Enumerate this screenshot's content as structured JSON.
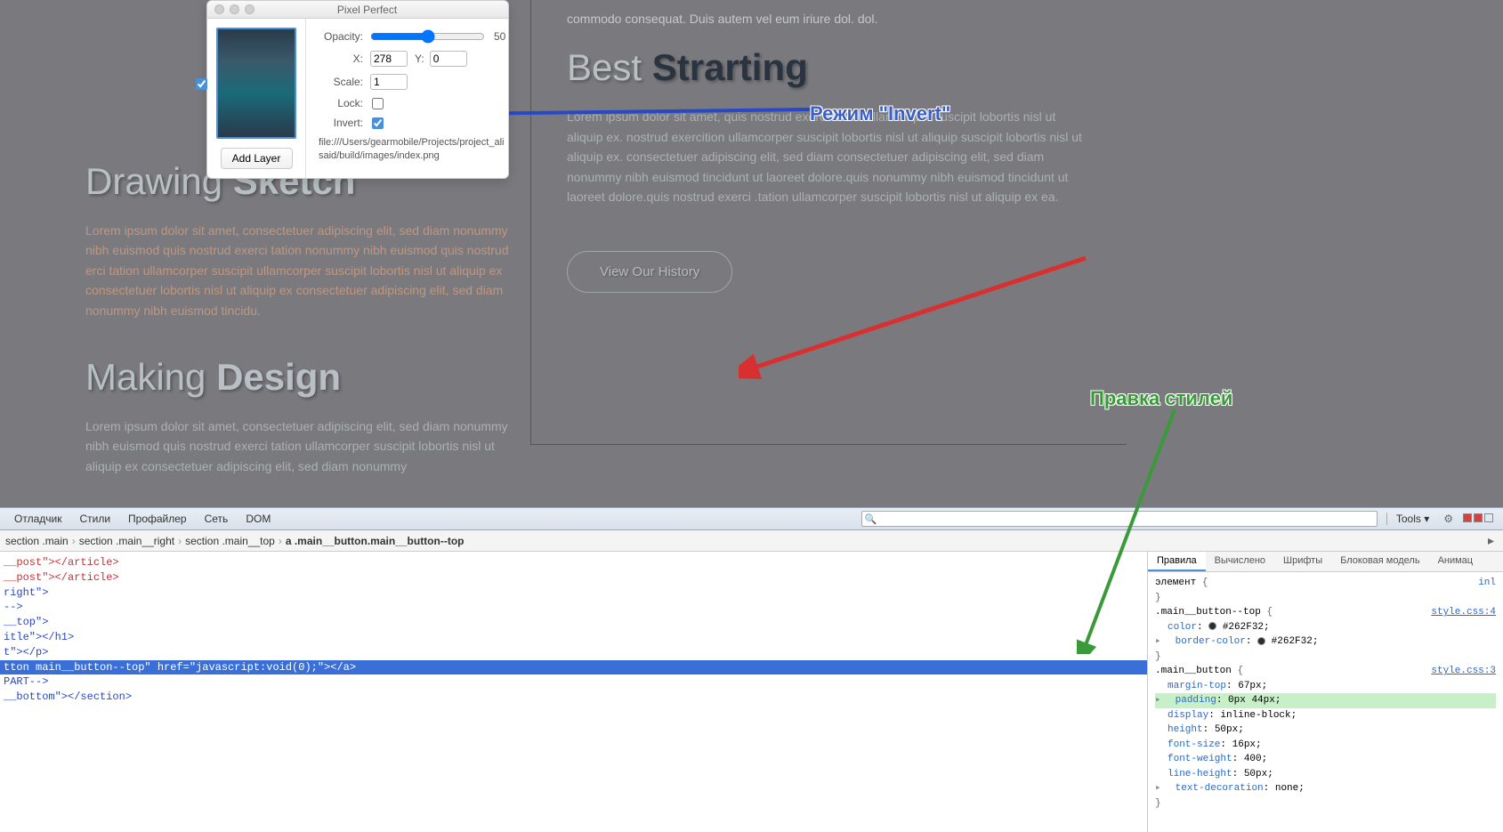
{
  "page": {
    "top_right_text": "commodo consequat. Duis autem vel eum iriure dol. dol.",
    "left": {
      "title1_a": "Drawing ",
      "title1_b": "Sketch",
      "text1": "Lorem ipsum dolor sit amet, consectetuer adipiscing elit, sed diam nonummy nibh euismod quis nostrud exerci tation nonummy nibh euismod quis nostrud erci tation ullamcorper suscipit ullamcorper suscipit lobortis nisl ut aliquip ex consectetuer lobortis nisl ut aliquip ex consectetuer adipiscing elit, sed diam nonummy nibh euismod tincidu.",
      "title2_a": "Making ",
      "title2_b": "Design",
      "text2": "Lorem ipsum dolor sit amet, consectetuer adipiscing elit, sed diam nonummy nibh euismod quis nostrud exerci tation ullamcorper suscipit lobortis nisl ut aliquip ex consectetuer adipiscing elit, sed diam nonummy"
    },
    "right": {
      "title_a": "Best ",
      "title_b": "Strarting",
      "text": "Lorem ipsum dolor sit amet, quis nostrud exerci tation ullamcorper suscipit lobortis nisl ut aliquip ex. nostrud exercition ullamcorper suscipit lobortis nisl ut aliquip suscipit lobortis nisl ut aliquip ex. consectetuer adipiscing elit, sed diam consectetuer adipiscing elit, sed diam nonummy nibh euismod tincidunt ut laoreet dolore.quis nonummy nibh euismod tincidunt ut laoreet dolore.quis nostrud exerci .tation ullamcorper suscipit lobortis nisl ut aliquip ex ea.",
      "button": "View Our History"
    }
  },
  "pp": {
    "title": "Pixel Perfect",
    "opacity_label": "Opacity:",
    "opacity_value": "50",
    "x_label": "X:",
    "x_value": "278",
    "y_label": "Y:",
    "y_value": "0",
    "scale_label": "Scale:",
    "scale_value": "1",
    "lock_label": "Lock:",
    "invert_label": "Invert:",
    "path": "file:///Users/gearmobile/Projects/project_alisaid/build/images/index.png",
    "add_layer": "Add Layer"
  },
  "annotations": {
    "invert": "Режим \"Invert\"",
    "styles": "Правка стилей"
  },
  "devtools": {
    "tabs": [
      "Отладчик",
      "Стили",
      "Профайлер",
      "Сеть",
      "DOM"
    ],
    "tools": "Tools",
    "crumbs": [
      "section .main",
      "section .main__right",
      "section .main__top",
      "a .main__button.main__button--top"
    ],
    "dom_lines": [
      {
        "cls": "tag-r",
        "txt": "__post\"></article>"
      },
      {
        "cls": "tag-r",
        "txt": "__post\"></article>"
      },
      {
        "cls": "",
        "txt": ""
      },
      {
        "cls": "tag-b",
        "txt": "right\">"
      },
      {
        "cls": "tag-b",
        "txt": "-->"
      },
      {
        "cls": "tag-b",
        "txt": "__top\">"
      },
      {
        "cls": "tag-b",
        "txt": "itle\"></h1>"
      },
      {
        "cls": "tag-b",
        "txt": "t\"></p>"
      },
      {
        "cls": "hl",
        "txt": "tton main__button--top\" href=\"javascript:void(0);\"></a>"
      },
      {
        "cls": "",
        "txt": ""
      },
      {
        "cls": "tag-b",
        "txt": "PART-->"
      },
      {
        "cls": "tag-b",
        "txt": "__bottom\"></section>"
      }
    ],
    "styles_tabs": [
      "Правила",
      "Вычислено",
      "Шрифты",
      "Блоковая модель",
      "Анимац"
    ],
    "rules": {
      "elem_label": "элемент",
      "inl": "inl",
      "r1_sel": ".main__button--top",
      "r1_src": "style.css:4",
      "r1_props": [
        {
          "n": "color",
          "v": "#262F32;",
          "sw": true
        },
        {
          "n": "border-color",
          "v": "#262F32;",
          "sw": true,
          "tri": true
        }
      ],
      "r2_sel": ".main__button",
      "r2_src": "style.css:3",
      "r2_props": [
        {
          "n": "margin-top",
          "v": "67px;"
        },
        {
          "n": "padding",
          "v": "0px 44px;",
          "hl": true,
          "tri": true
        },
        {
          "n": "display",
          "v": "inline-block;"
        },
        {
          "n": "height",
          "v": "50px;"
        },
        {
          "n": "font-size",
          "v": "16px;"
        },
        {
          "n": "font-weight",
          "v": "400;"
        },
        {
          "n": "line-height",
          "v": "50px;"
        },
        {
          "n": "text-decoration",
          "v": "none;",
          "tri": true
        }
      ]
    }
  }
}
